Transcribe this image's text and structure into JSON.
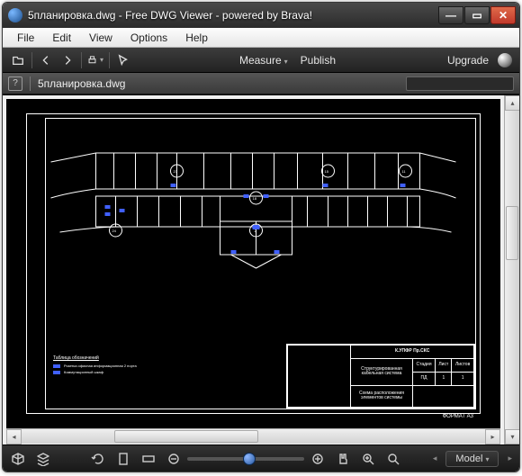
{
  "window": {
    "title": "5планировка.dwg - Free DWG Viewer - powered by Brava!"
  },
  "menu": {
    "file": "File",
    "edit": "Edit",
    "view": "View",
    "options": "Options",
    "help": "Help"
  },
  "toolbar": {
    "measure": "Measure",
    "publish": "Publish",
    "upgrade": "Upgrade"
  },
  "tab": {
    "filename": "5планировка.dwg"
  },
  "drawing": {
    "title_block": {
      "project": "К.УПФР Пр.СКС",
      "system_line1": "Структурированная",
      "system_line2": "кабельная система",
      "scheme": "Схема расположения элементов системы",
      "h_stage": "Стадия",
      "h_sheet": "Лист",
      "h_sheets": "Листов",
      "v_stage": "ПД",
      "v_sheet": "1",
      "v_sheets": "1"
    },
    "format": "ФОРМАТ  A3",
    "markers": {
      "m1": "23",
      "m2": "15",
      "m3": "11",
      "m4": "18",
      "m5": "2",
      "m6": "24"
    },
    "legend": {
      "title": "Таблица обозначений",
      "r1": "Розетка офисная информационная 2 порта",
      "r2": "Коммутационный шкаф"
    }
  },
  "bottom": {
    "model": "Model"
  }
}
